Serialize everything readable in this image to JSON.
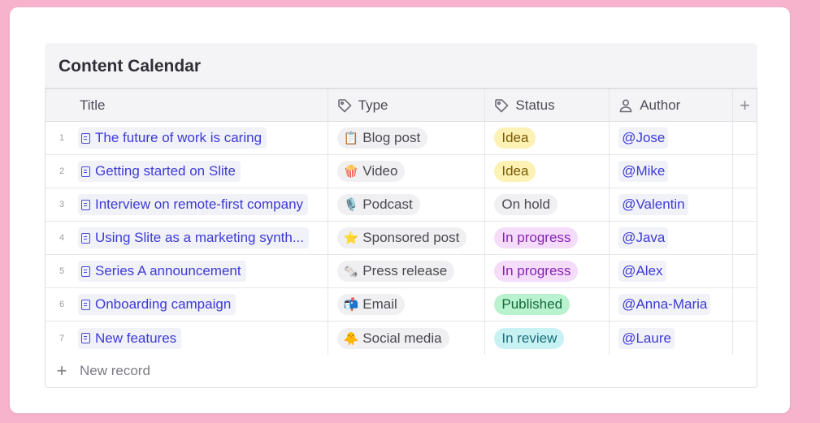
{
  "database": {
    "title": "Content Calendar",
    "columns": [
      {
        "label": "Title",
        "icon": "none"
      },
      {
        "label": "Type",
        "icon": "tag-icon"
      },
      {
        "label": "Status",
        "icon": "tag-icon"
      },
      {
        "label": "Author",
        "icon": "person-icon"
      }
    ],
    "add_column_label": "+",
    "rows": [
      {
        "num": "1",
        "title": "The future of work is caring",
        "type": "Blog post",
        "type_emoji": "📋",
        "status": "Idea",
        "status_bg": "#fdf1b3",
        "status_fg": "#7a5a00",
        "author": "@Jose"
      },
      {
        "num": "2",
        "title": "Getting started on Slite",
        "type": "Video",
        "type_emoji": "🍿",
        "status": "Idea",
        "status_bg": "#fdf1b3",
        "status_fg": "#7a5a00",
        "author": "@Mike"
      },
      {
        "num": "3",
        "title": "Interview on remote-first company",
        "type": "Podcast",
        "type_emoji": "🎙️",
        "status": "On hold",
        "status_bg": "#f0f0f2",
        "status_fg": "#4a4a52",
        "author": "@Valentin"
      },
      {
        "num": "4",
        "title": "Using Slite as a marketing synth...",
        "type": "Sponsored post",
        "type_emoji": "⭐",
        "status": "In progress",
        "status_bg": "#f4dcfa",
        "status_fg": "#8a1fb5",
        "author": "@Java"
      },
      {
        "num": "5",
        "title": "Series A announcement",
        "type": "Press release",
        "type_emoji": "🗞️",
        "status": "In progress",
        "status_bg": "#f4dcfa",
        "status_fg": "#8a1fb5",
        "author": "@Alex"
      },
      {
        "num": "6",
        "title": "Onboarding campaign",
        "type": "Email",
        "type_emoji": "📬",
        "status": "Published",
        "status_bg": "#b9f2cf",
        "status_fg": "#166a39",
        "author": "@Anna-Maria"
      },
      {
        "num": "7",
        "title": "New features",
        "type": "Social media",
        "type_emoji": "🐥",
        "status": "In review",
        "status_bg": "#c8f1f4",
        "status_fg": "#16707a",
        "author": "@Laure"
      }
    ],
    "new_record_label": "New record"
  }
}
